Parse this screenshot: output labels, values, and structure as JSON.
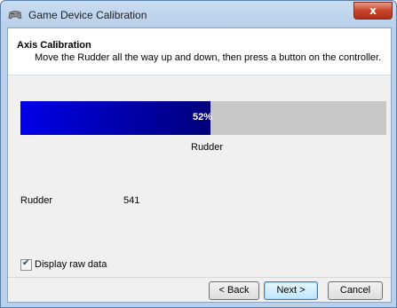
{
  "window": {
    "title": "Game Device Calibration",
    "close_glyph": "x"
  },
  "header": {
    "title": "Axis Calibration",
    "subtitle": "Move the Rudder all the way up and down, then press a button on the controller."
  },
  "progress": {
    "percent": 52,
    "text": "52%",
    "axis_label": "Rudder",
    "fill_color": "#0000e0",
    "track_color": "#c8c8c8"
  },
  "raw_data": {
    "label": "Rudder",
    "value": "541"
  },
  "display_raw": {
    "label": "Display raw data",
    "checked": true
  },
  "buttons": {
    "back": "< Back",
    "next": "Next >",
    "cancel": "Cancel"
  },
  "icons": {
    "title_icon": "game-controller-icon",
    "checkbox_mark": "checkmark-icon"
  }
}
